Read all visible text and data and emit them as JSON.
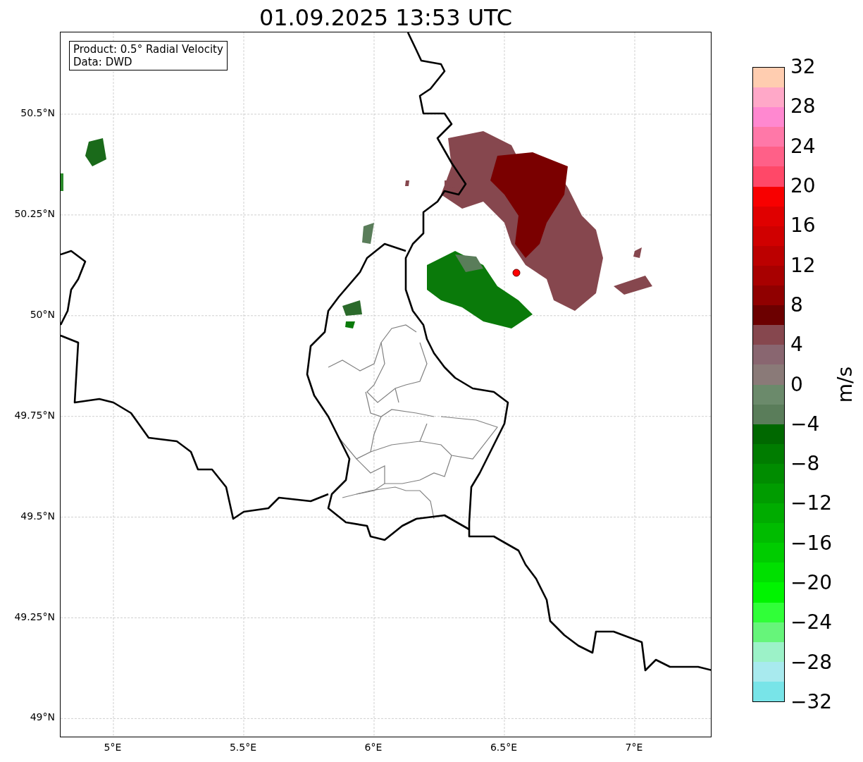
{
  "title": "01.09.2025 13:53 UTC",
  "legend": {
    "lines": [
      "Product: 0.5° Radial Velocity",
      "Data: DWD"
    ]
  },
  "map": {
    "lat_ticks": [
      "50.5°N",
      "50.25°N",
      "50°N",
      "49.75°N",
      "49.5°N",
      "49.25°N",
      "49°N"
    ],
    "lon_ticks": [
      "5°E",
      "5.5°E",
      "6°E",
      "6.5°E",
      "7°E"
    ]
  },
  "colorbar": {
    "label": "m/s",
    "ticks": [
      "32",
      "28",
      "24",
      "20",
      "16",
      "12",
      "8",
      "4",
      "0",
      "−4",
      "−8",
      "−12",
      "−16",
      "−20",
      "−24",
      "−28",
      "−32"
    ],
    "bins": [
      {
        "color": "#ffcdb0"
      },
      {
        "color": "#ffa8c8"
      },
      {
        "color": "#ff88d0"
      },
      {
        "color": "#ff78a8"
      },
      {
        "color": "#ff6088"
      },
      {
        "color": "#ff4868"
      },
      {
        "color": "#f80000"
      },
      {
        "color": "#e00000"
      },
      {
        "color": "#d00000"
      },
      {
        "color": "#bc0000"
      },
      {
        "color": "#a80000"
      },
      {
        "color": "#900000"
      },
      {
        "color": "#6c0000"
      },
      {
        "color": "#86474e"
      },
      {
        "color": "#896670"
      },
      {
        "color": "#8a7a78"
      },
      {
        "color": "#6b8a6b"
      },
      {
        "color": "#5a7d5a"
      },
      {
        "color": "#006800"
      },
      {
        "color": "#007c00"
      },
      {
        "color": "#008c00"
      },
      {
        "color": "#009c00"
      },
      {
        "color": "#00ac00"
      },
      {
        "color": "#00bc00"
      },
      {
        "color": "#00cc00"
      },
      {
        "color": "#00e000"
      },
      {
        "color": "#00f400"
      },
      {
        "color": "#30ff38"
      },
      {
        "color": "#66f57a"
      },
      {
        "color": "#9cf2c8"
      },
      {
        "color": "#a8eaee"
      },
      {
        "color": "#78e4e8"
      }
    ]
  }
}
